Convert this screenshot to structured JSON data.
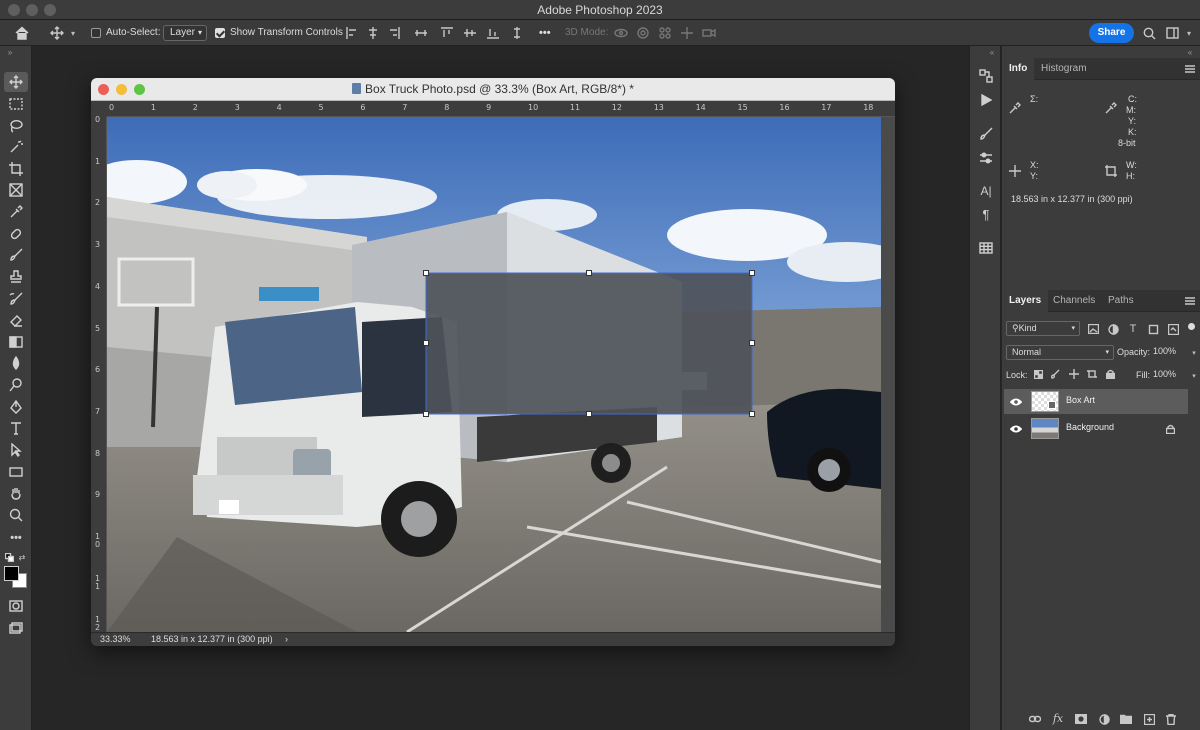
{
  "app": {
    "title": "Adobe Photoshop 2023"
  },
  "options_bar": {
    "auto_select_label": "Auto-Select:",
    "auto_select_checked": false,
    "layer_select_value": "Layer",
    "transform_controls_label": "Show Transform Controls",
    "transform_controls_checked": true,
    "more": "•••",
    "mode_3d": "3D Mode:",
    "share_label": "Share"
  },
  "document": {
    "title": "Box Truck Photo.psd @ 33.3% (Box Art, RGB/8*) *",
    "zoom": "33.33%",
    "doc_size": "18.563 in x 12.377 in (300 ppi)",
    "status_arrow": "›",
    "ruler_h": [
      "0",
      "1",
      "2",
      "3",
      "4",
      "5",
      "6",
      "7",
      "8",
      "9",
      "10",
      "11",
      "12",
      "13",
      "14",
      "15",
      "16",
      "17",
      "18"
    ],
    "ruler_v": [
      "0",
      "1",
      "2",
      "3",
      "4",
      "5",
      "6",
      "7",
      "8",
      "9",
      "10",
      "11",
      "12"
    ]
  },
  "info_panel": {
    "tabs": [
      "Info",
      "Histogram"
    ],
    "active_tab": "Info",
    "sigma": "Σ:",
    "cmyk_labels": [
      "C:",
      "M:",
      "Y:",
      "K:"
    ],
    "bit_depth": "8-bit",
    "x_label": "X:",
    "y_label": "Y:",
    "w_label": "W:",
    "h_label": "H:",
    "doc_size": "18.563 in x 12.377 in (300 ppi)"
  },
  "layers_panel": {
    "tabs": [
      "Layers",
      "Channels",
      "Paths"
    ],
    "active_tab": "Layers",
    "filter_value": "Kind",
    "blend_mode": "Normal",
    "opacity_label": "Opacity:",
    "opacity_value": "100%",
    "lock_label": "Lock:",
    "fill_label": "Fill:",
    "fill_value": "100%",
    "layers": [
      {
        "name": "Box Art",
        "selected": true,
        "locked": false
      },
      {
        "name": "Background",
        "selected": false,
        "locked": true
      }
    ]
  },
  "colors": {
    "accent": "#1473e6",
    "selection": "#5c5c5c"
  }
}
